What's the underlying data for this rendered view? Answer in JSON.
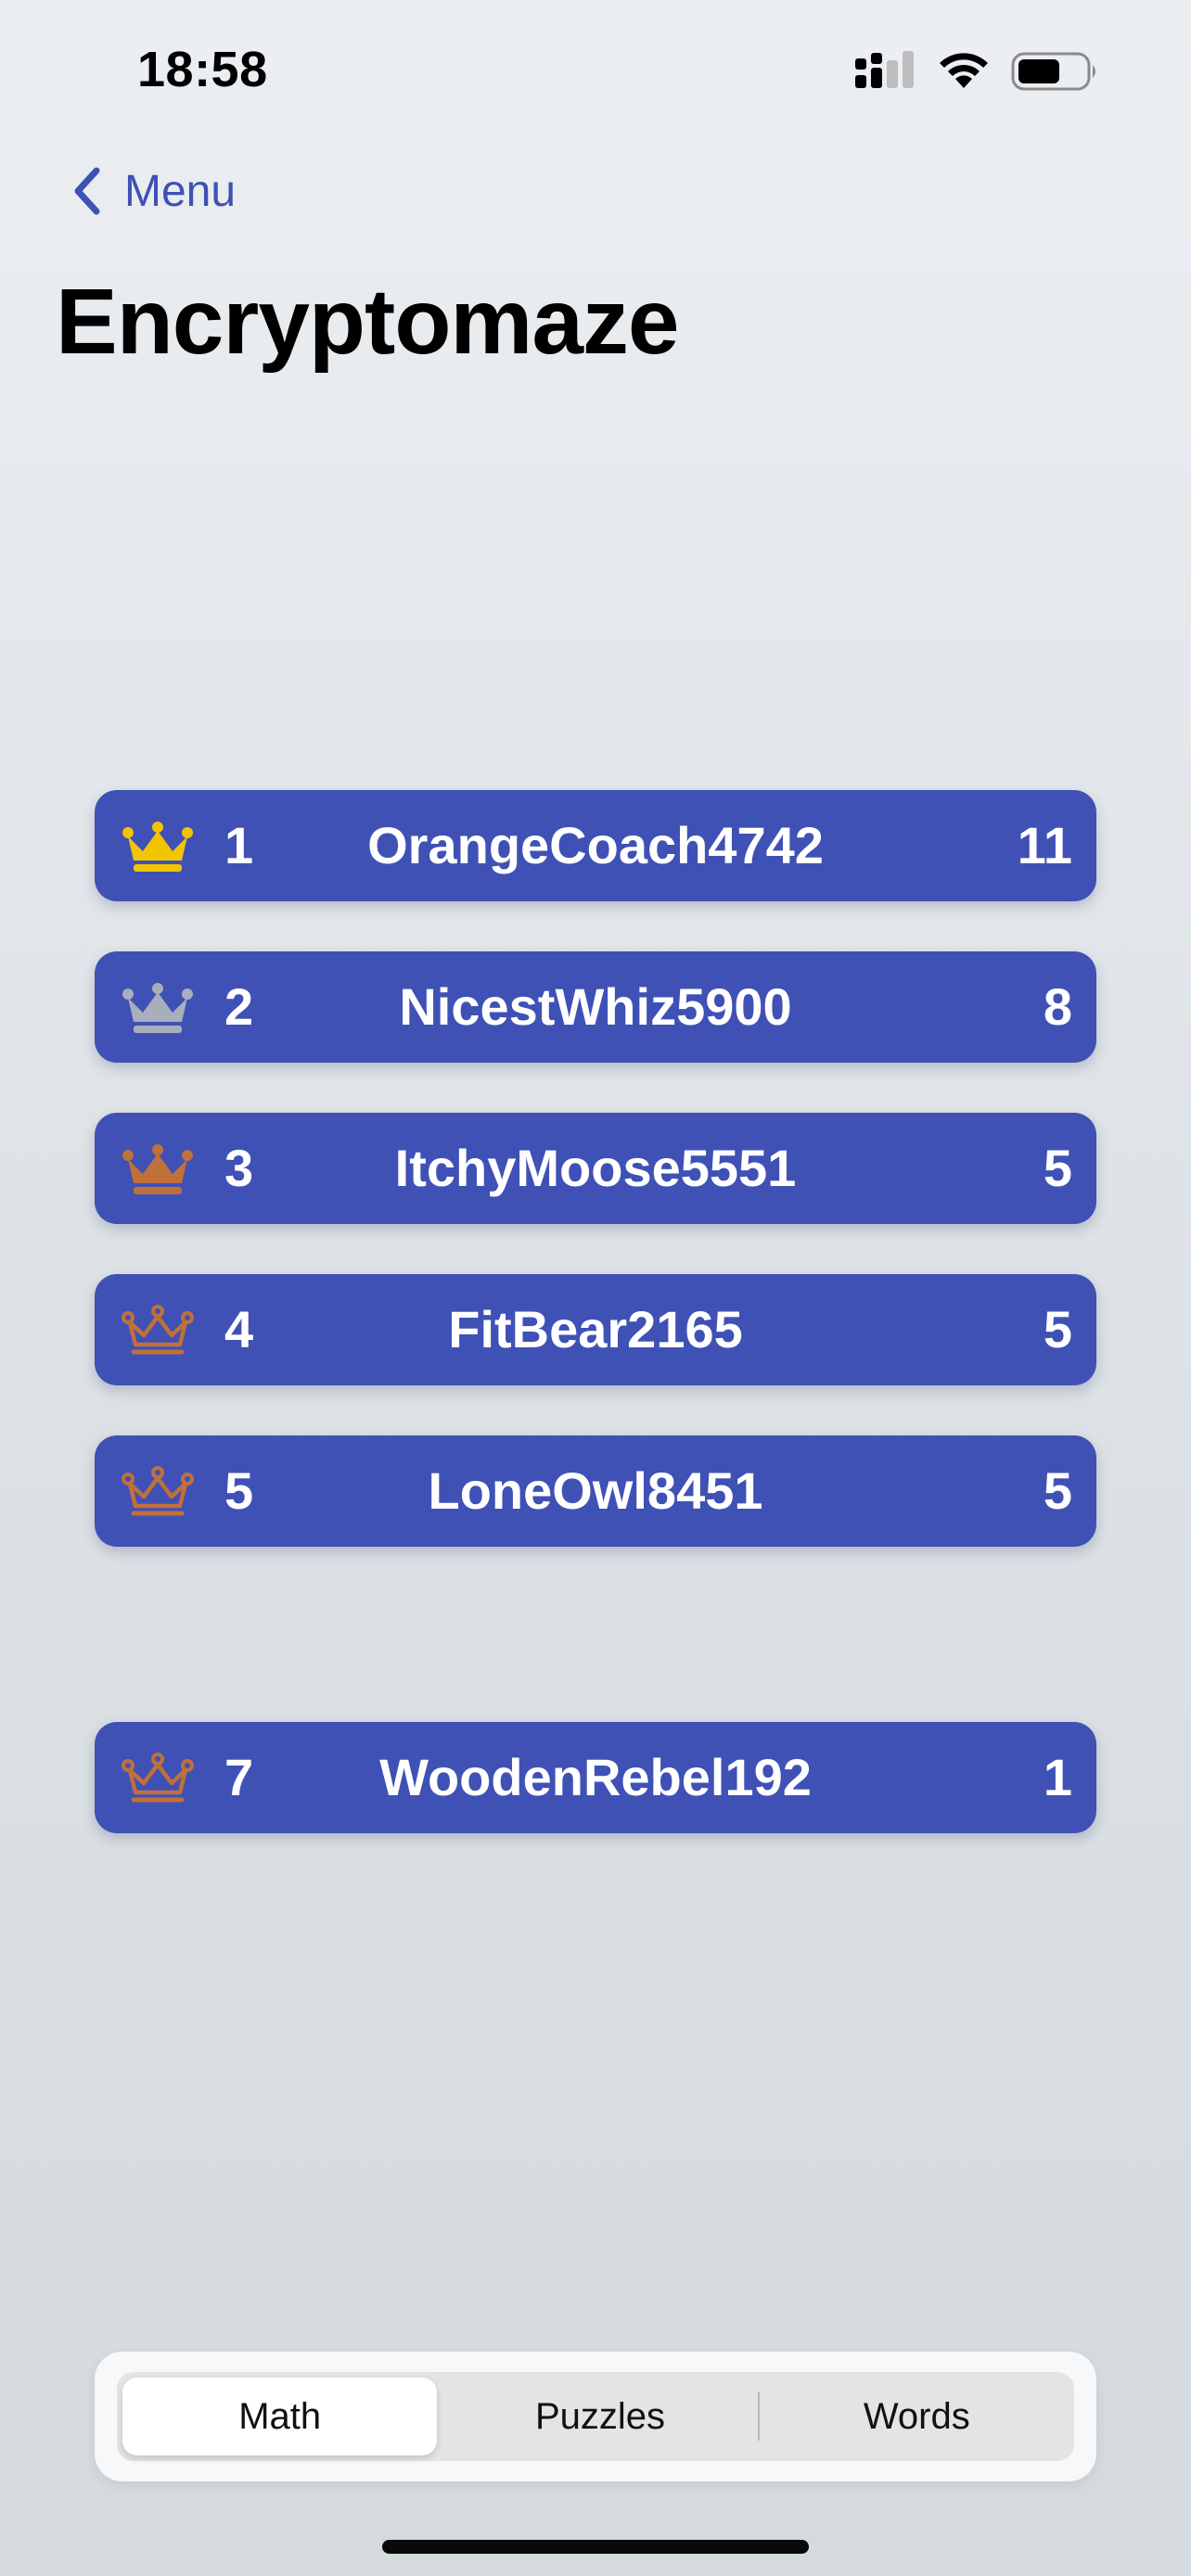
{
  "status_bar": {
    "time": "18:58"
  },
  "nav": {
    "back_label": "Menu"
  },
  "title": "Encryptomaze",
  "leaderboard": [
    {
      "rank": "1",
      "name": "OrangeCoach4742",
      "score": "11",
      "crown": "gold"
    },
    {
      "rank": "2",
      "name": "NicestWhiz5900",
      "score": "8",
      "crown": "silver"
    },
    {
      "rank": "3",
      "name": "ItchyMoose5551",
      "score": "5",
      "crown": "bronze"
    },
    {
      "rank": "4",
      "name": "FitBear2165",
      "score": "5",
      "crown": "outline"
    },
    {
      "rank": "5",
      "name": "LoneOwl8451",
      "score": "5",
      "crown": "outline"
    },
    {
      "rank": "7",
      "name": "WoodenRebel192",
      "score": "1",
      "crown": "outline"
    }
  ],
  "tabs": [
    {
      "label": "Math",
      "selected": true
    },
    {
      "label": "Puzzles",
      "selected": false
    },
    {
      "label": "Words",
      "selected": false
    }
  ],
  "colors": {
    "accent": "#3f51b5",
    "gold": "#f2c500",
    "silver": "#a9aebb",
    "bronze": "#c0703a"
  }
}
